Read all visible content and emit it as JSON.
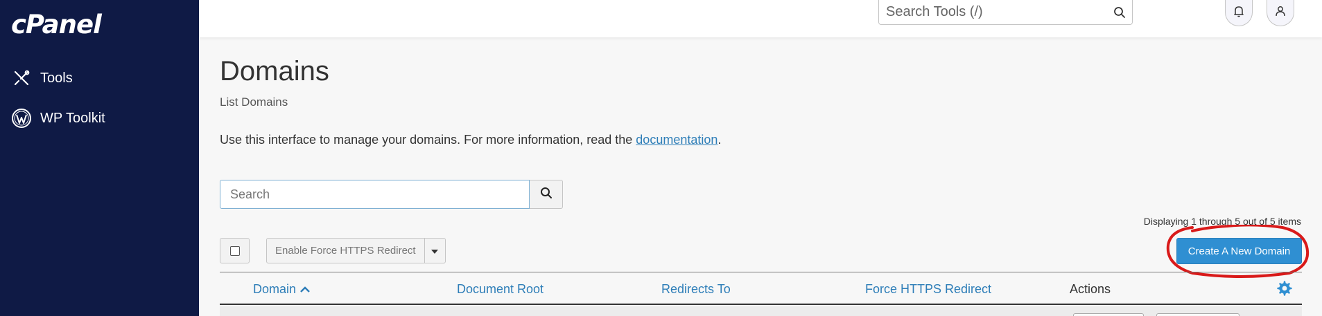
{
  "brand": {
    "logo_text": "cPanel"
  },
  "sidebar": {
    "items": [
      {
        "label": "Tools",
        "icon": "tools-icon"
      },
      {
        "label": "WP Toolkit",
        "icon": "wordpress-icon"
      }
    ]
  },
  "topbar": {
    "search_placeholder": "Search Tools (/)"
  },
  "page": {
    "title": "Domains",
    "subtitle": "List Domains",
    "intro_text": "Use this interface to manage your domains. For more information, read the ",
    "intro_link": "documentation",
    "intro_end": "."
  },
  "list_search": {
    "placeholder": "Search"
  },
  "paging": {
    "text": "Displaying 1 through 5 out of 5 items"
  },
  "bulk": {
    "label": "Enable Force HTTPS Redirect"
  },
  "create_button": {
    "label": "Create A New Domain"
  },
  "table": {
    "columns": [
      "Domain",
      "Document Root",
      "Redirects To",
      "Force HTTPS Redirect",
      "Actions"
    ],
    "sort": {
      "column": "Domain",
      "direction": "ascending"
    }
  },
  "colors": {
    "sidebar": "#0f1a45",
    "accent": "#2f8fd2",
    "link": "#2e7eb8",
    "annotation": "#d91a1a"
  }
}
